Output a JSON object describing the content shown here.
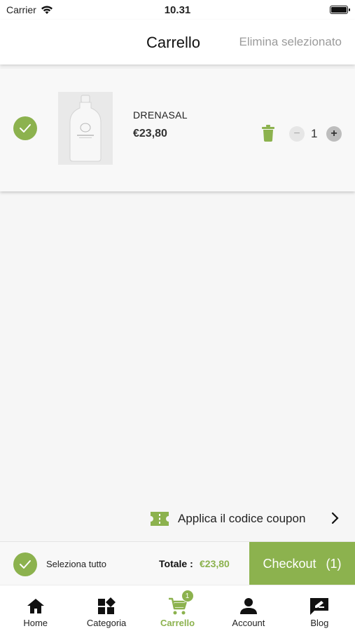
{
  "status_bar": {
    "carrier": "Carrier",
    "time": "10.31"
  },
  "header": {
    "title": "Carrello",
    "delete_selected_label": "Elimina selezionato"
  },
  "cart": {
    "items": [
      {
        "name": "DRENASAL",
        "price": "€23,80",
        "quantity": "1",
        "selected": true
      }
    ]
  },
  "coupon": {
    "label": "Applica il codice coupon"
  },
  "summary": {
    "select_all_label": "Seleziona tutto",
    "total_label": "Totale :",
    "total_value": "€23,80",
    "checkout_label": "Checkout",
    "checkout_count": "(1)"
  },
  "tabs": [
    {
      "label": "Home",
      "icon": "home-icon"
    },
    {
      "label": "Categoria",
      "icon": "category-icon"
    },
    {
      "label": "Carrello",
      "icon": "cart-icon",
      "badge": "1",
      "active": true
    },
    {
      "label": "Account",
      "icon": "account-icon"
    },
    {
      "label": "Blog",
      "icon": "blog-icon"
    }
  ],
  "colors": {
    "accent": "#8cb24e",
    "muted": "#9b9b9b",
    "background": "#f6f6f6"
  }
}
